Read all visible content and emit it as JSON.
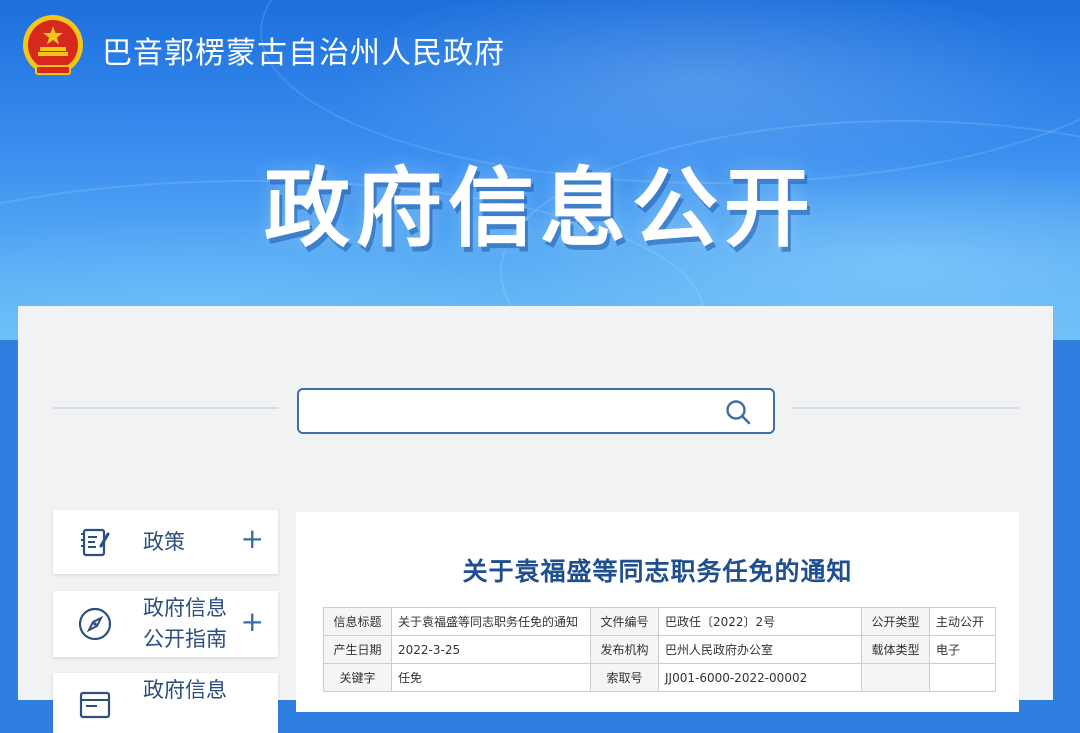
{
  "header": {
    "site_title": "巴音郭楞蒙古自治州人民政府",
    "hero_title": "政府信息公开"
  },
  "search": {
    "placeholder": ""
  },
  "sidebar": {
    "items": [
      {
        "label_line1": "政策",
        "label_line2": "",
        "icon": "policy-document-icon"
      },
      {
        "label_line1": "政府信息",
        "label_line2": "公开指南",
        "icon": "compass-icon"
      },
      {
        "label_line1": "政府信息",
        "label_line2": "",
        "icon": "browser-window-icon"
      }
    ],
    "expand_symbol": "+"
  },
  "article": {
    "title": "关于袁福盛等同志职务任免的通知",
    "meta": {
      "row1": {
        "k1": "信息标题",
        "v1": "关于袁福盛等同志职务任免的通知",
        "k2": "文件编号",
        "v2": "巴政任〔2022〕2号",
        "k3": "公开类型",
        "v3": "主动公开"
      },
      "row2": {
        "k1": "产生日期",
        "v1": "2022-3-25",
        "k2": "发布机构",
        "v2": "巴州人民政府办公室",
        "k3": "载体类型",
        "v3": "电子"
      },
      "row3": {
        "k1": "关键字",
        "v1": "任免",
        "k2": "索取号",
        "v2": "JJ001-6000-2022-00002",
        "k3": "",
        "v3": ""
      }
    }
  },
  "colors": {
    "primary_blue": "#1f4f8e",
    "banner_blue": "#2f7fe0"
  }
}
